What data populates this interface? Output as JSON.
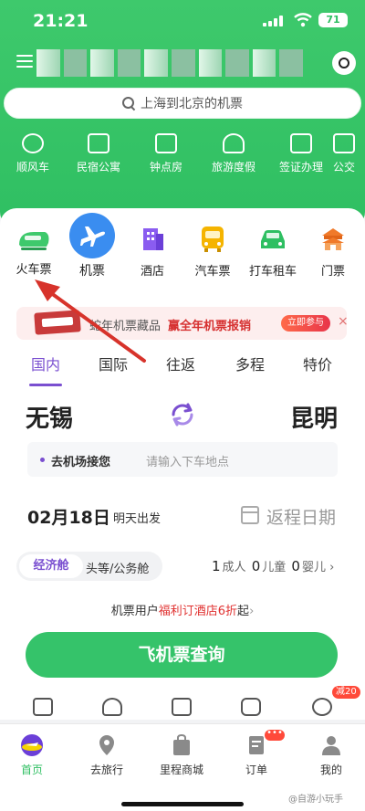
{
  "status_bar": {
    "time": "21:21",
    "battery": "71"
  },
  "search": {
    "placeholder": "上海到北京的机票"
  },
  "services": [
    {
      "label": "顺风车",
      "icon": "carpool-icon"
    },
    {
      "label": "民宿公寓",
      "icon": "homestay-icon"
    },
    {
      "label": "钟点房",
      "icon": "hourly-room-icon"
    },
    {
      "label": "旅游度假",
      "icon": "vacation-icon"
    },
    {
      "label": "签证办理",
      "icon": "visa-icon"
    },
    {
      "label": "公交",
      "icon": "bus-icon"
    }
  ],
  "categories": [
    {
      "label": "火车票",
      "icon": "train-icon",
      "color": "#3ec96c"
    },
    {
      "label": "机票",
      "icon": "airplane-icon",
      "color": "#3a8df0"
    },
    {
      "label": "酒店",
      "icon": "hotel-icon",
      "color": "#8a5cf0"
    },
    {
      "label": "汽车票",
      "icon": "coach-icon",
      "color": "#f5b400"
    },
    {
      "label": "打车租车",
      "icon": "taxi-icon",
      "color": "#2fbf62"
    },
    {
      "label": "门票",
      "icon": "ticket-gate-icon",
      "color": "#f07a2a"
    }
  ],
  "promo": {
    "text": "蛇年机票藏品",
    "highlight": "赢全年机票报销",
    "button": "立即参与",
    "close": "×"
  },
  "tabs": [
    "国内",
    "国际",
    "往返",
    "多程",
    "特价"
  ],
  "route": {
    "from": "无锡",
    "to": "昆明"
  },
  "pickup": {
    "title": "去机场接您",
    "placeholder": "请输入下车地点"
  },
  "date": {
    "depart": "02月18日",
    "depart_note": "明天出发",
    "return": "返程日期"
  },
  "cabin": {
    "option1": "经济舱",
    "option2": "头等/公务舱"
  },
  "passengers": {
    "adult_count": "1",
    "adult_label": "成人",
    "child_count": "0",
    "child_label": "儿童",
    "infant_count": "0",
    "infant_label": "婴儿",
    "arrow": "›"
  },
  "benefit": {
    "prefix": "机票用户",
    "red1": "福利订",
    "mid": "酒店",
    "red2": "6折",
    "suffix": "起",
    "arrow": "›"
  },
  "query_button": "飞机票查询",
  "mini_badge": "减20",
  "bottom_nav": [
    {
      "label": "首页",
      "icon": "home-icon"
    },
    {
      "label": "去旅行",
      "icon": "location-pin-icon"
    },
    {
      "label": "里程商城",
      "icon": "shopping-bag-icon"
    },
    {
      "label": "订单",
      "icon": "order-icon"
    },
    {
      "label": "我的",
      "icon": "profile-icon"
    }
  ],
  "nav_badge": "•••",
  "watermark": "@自游小玩手",
  "colors": {
    "brand_green": "#2fbf62",
    "accent_purple": "#7a4fd0",
    "promo_red": "#e0302f"
  }
}
